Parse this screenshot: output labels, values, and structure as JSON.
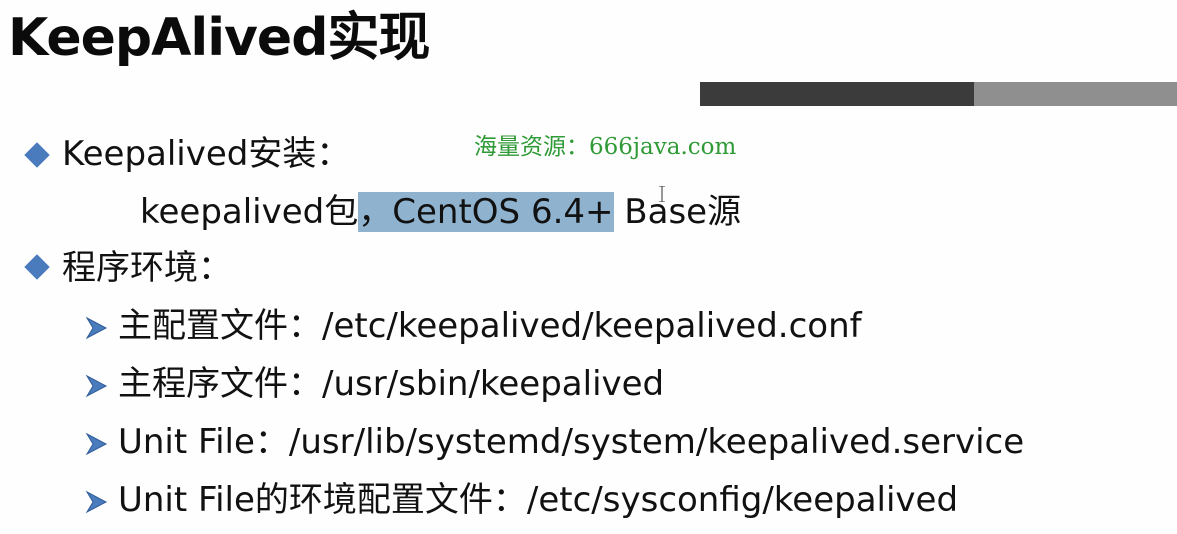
{
  "slide": {
    "title": "KeepAlived实现",
    "watermark": "海量资源：666java.com",
    "bullets": [
      {
        "label": "Keepalived安装：",
        "detail": {
          "before": "keepalived包",
          "highlighted": "，CentOS 6.4+",
          "after": " Base源"
        }
      },
      {
        "label": "程序环境：",
        "subitems": [
          "主配置文件：/etc/keepalived/keepalived.conf",
          "主程序文件：/usr/sbin/keepalived",
          "Unit File：/usr/lib/systemd/system/keepalived.service",
          "Unit File的环境配置文件：/etc/sysconfig/keepalived"
        ]
      }
    ]
  },
  "icons": {
    "bullet": "diamond-bullet-icon",
    "subbullet": "arrow-bullet-icon",
    "cursor": "text-cursor-icon"
  },
  "colors": {
    "bullet": "#4a7bbd",
    "watermark": "#2f9a36",
    "highlight": "#8fb3cf",
    "bar_dark": "#3b3b3b",
    "bar_light": "#8f8f8f"
  }
}
